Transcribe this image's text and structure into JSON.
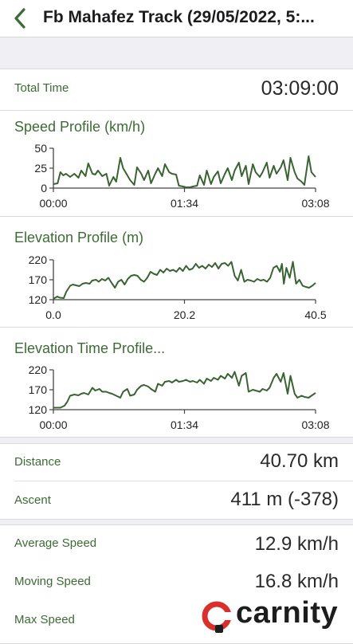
{
  "nav": {
    "title": "Fb Mahafez Track (29/05/2022, 5:..."
  },
  "total_time": {
    "label": "Total Time",
    "value": "03:09:00"
  },
  "stats": {
    "distance": {
      "label": "Distance",
      "value": "40.70 km"
    },
    "ascent": {
      "label": "Ascent",
      "value": "411 m (-378)"
    },
    "average_speed": {
      "label": "Average Speed",
      "value": "12.9 km/h"
    },
    "moving_speed": {
      "label": "Moving Speed",
      "value": "16.8 km/h"
    },
    "max_speed": {
      "label": "Max Speed"
    }
  },
  "watermark": {
    "text": "carnity"
  },
  "colors": {
    "accent": "#3d6b35",
    "line": "#3a6332"
  },
  "chart_data": [
    {
      "type": "line",
      "title": "Speed Profile (km/h)",
      "ylim": [
        0,
        50
      ],
      "yticks": [
        "50",
        "25",
        "0"
      ],
      "xlim": [
        0,
        188
      ],
      "xticks": [
        "00:00",
        "01:34",
        "03:08"
      ],
      "x": [
        0,
        3,
        5,
        7,
        9,
        12,
        15,
        18,
        20,
        23,
        25,
        28,
        30,
        32,
        35,
        38,
        40,
        43,
        45,
        48,
        50,
        53,
        55,
        58,
        60,
        63,
        65,
        68,
        70,
        73,
        75,
        78,
        80,
        83,
        85,
        88,
        90,
        93,
        95,
        98,
        100,
        103,
        105,
        108,
        110,
        113,
        115,
        118,
        120,
        123,
        125,
        128,
        130,
        133,
        135,
        138,
        140,
        143,
        145,
        148,
        150,
        153,
        155,
        158,
        160,
        163,
        165,
        168,
        170,
        173,
        175,
        178,
        180,
        183,
        185,
        188
      ],
      "y": [
        5,
        6,
        20,
        16,
        18,
        14,
        18,
        13,
        22,
        15,
        31,
        18,
        17,
        22,
        15,
        18,
        3,
        14,
        8,
        38,
        25,
        16,
        10,
        4,
        26,
        18,
        10,
        22,
        6,
        18,
        25,
        15,
        30,
        20,
        18,
        17,
        3,
        2,
        1,
        1,
        2,
        3,
        16,
        4,
        22,
        5,
        14,
        21,
        6,
        18,
        25,
        10,
        22,
        32,
        15,
        28,
        5,
        30,
        20,
        14,
        20,
        32,
        13,
        28,
        18,
        26,
        35,
        10,
        38,
        20,
        12,
        8,
        4,
        40,
        20,
        14
      ]
    },
    {
      "type": "line",
      "title": "Elevation Profile (m)",
      "ylim": [
        120,
        220
      ],
      "yticks": [
        "220",
        "170",
        "120"
      ],
      "xlim": [
        0,
        40.5
      ],
      "xticks": [
        "0.0",
        "20.2",
        "40.5"
      ],
      "x": [
        0,
        0.6,
        1.0,
        1.6,
        2.0,
        2.6,
        3.0,
        3.5,
        4.0,
        4.5,
        5.0,
        5.6,
        6.0,
        6.6,
        7.0,
        7.5,
        8.0,
        8.5,
        9.0,
        9.5,
        10.0,
        10.5,
        11.0,
        11.5,
        12.0,
        12.5,
        13.0,
        13.5,
        14.0,
        14.5,
        15.0,
        15.5,
        16.0,
        16.5,
        17.0,
        17.5,
        18.0,
        18.5,
        19.0,
        19.5,
        20.0,
        20.5,
        21.0,
        21.5,
        22.0,
        22.5,
        23.0,
        23.5,
        24.0,
        24.5,
        25.0,
        25.5,
        26.0,
        26.5,
        27.0,
        27.5,
        28.0,
        28.5,
        29.0,
        29.5,
        30.0,
        30.5,
        31.0,
        31.5,
        32.0,
        32.5,
        33.0,
        33.5,
        34.0,
        34.5,
        35.0,
        35.3,
        35.6,
        36.0,
        36.5,
        37.0,
        37.5,
        38.0,
        38.5,
        39.0,
        39.5,
        40.0,
        40.5
      ],
      "y": [
        122,
        128,
        125,
        124,
        140,
        155,
        158,
        156,
        154,
        160,
        162,
        160,
        168,
        170,
        165,
        172,
        168,
        175,
        162,
        150,
        165,
        170,
        158,
        172,
        180,
        182,
        180,
        170,
        165,
        175,
        190,
        185,
        182,
        195,
        188,
        198,
        192,
        195,
        190,
        200,
        192,
        205,
        195,
        198,
        210,
        200,
        205,
        198,
        208,
        202,
        212,
        198,
        210,
        212,
        205,
        215,
        180,
        168,
        195,
        165,
        170,
        168,
        165,
        172,
        168,
        170,
        165,
        175,
        200,
        205,
        190,
        210,
        160,
        200,
        175,
        215,
        160,
        170,
        155,
        152,
        150,
        155,
        162
      ]
    },
    {
      "type": "line",
      "title": "Elevation Time Profile...",
      "ylim": [
        120,
        220
      ],
      "yticks": [
        "220",
        "170",
        "120"
      ],
      "xlim": [
        0,
        188
      ],
      "xticks": [
        "00:00",
        "01:34",
        "03:08"
      ],
      "x": [
        0,
        5,
        8,
        10,
        12,
        15,
        18,
        20,
        22,
        25,
        28,
        30,
        33,
        35,
        38,
        40,
        42,
        45,
        48,
        50,
        53,
        55,
        58,
        60,
        63,
        65,
        68,
        70,
        73,
        75,
        78,
        80,
        83,
        85,
        88,
        90,
        93,
        95,
        98,
        100,
        103,
        105,
        108,
        110,
        113,
        115,
        118,
        120,
        123,
        125,
        128,
        130,
        133,
        135,
        138,
        140,
        143,
        145,
        148,
        150,
        153,
        155,
        158,
        160,
        163,
        165,
        168,
        170,
        173,
        175,
        178,
        180,
        183,
        185,
        188
      ],
      "y": [
        125,
        125,
        130,
        140,
        155,
        158,
        156,
        160,
        162,
        158,
        175,
        168,
        172,
        165,
        165,
        162,
        160,
        155,
        150,
        165,
        172,
        155,
        158,
        170,
        180,
        182,
        178,
        172,
        165,
        185,
        180,
        190,
        192,
        188,
        195,
        190,
        192,
        195,
        190,
        192,
        188,
        195,
        185,
        198,
        192,
        200,
        195,
        205,
        198,
        210,
        200,
        215,
        180,
        205,
        212,
        165,
        170,
        168,
        165,
        172,
        168,
        175,
        200,
        210,
        190,
        212,
        160,
        205,
        160,
        150,
        155,
        152,
        150,
        155,
        162
      ]
    }
  ]
}
